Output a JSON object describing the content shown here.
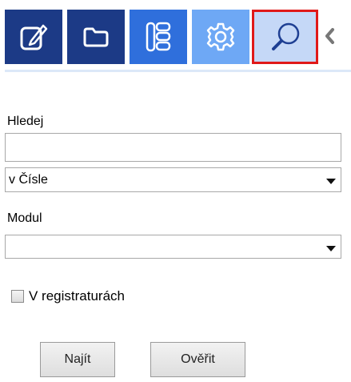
{
  "toolbar": {
    "tabs": [
      {
        "icon": "edit-document-icon",
        "state": "inactive"
      },
      {
        "icon": "folder-icon",
        "state": "inactive"
      },
      {
        "icon": "list-icon",
        "state": "inactive"
      },
      {
        "icon": "gear-icon",
        "state": "inactive"
      },
      {
        "icon": "search-icon",
        "state": "active-highlighted"
      }
    ],
    "collapse_icon": "chevron-left-icon"
  },
  "form": {
    "search_label": "Hledej",
    "search_value": "",
    "search_in_value": "v Čísle",
    "module_label": "Modul",
    "module_value": "",
    "registry_checkbox_label": "V registraturách",
    "registry_checked": false
  },
  "buttons": {
    "find_label": "Najít",
    "verify_label": "Ověřit"
  },
  "colors": {
    "tab_dark": "#1c3a86",
    "tab_mid": "#2f6fdc",
    "tab_light": "#6ea8f5",
    "tab_active": "#c5d8f7",
    "highlight": "#e01919"
  }
}
